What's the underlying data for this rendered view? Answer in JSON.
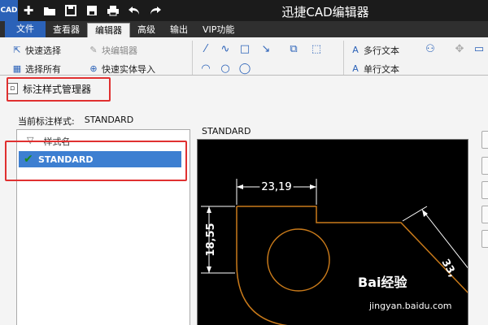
{
  "window": {
    "title": "迅捷CAD编辑器",
    "app_icon_text": "CAD"
  },
  "quick_access": [
    {
      "name": "new-icon",
      "glyph": "✚"
    },
    {
      "name": "open-folder-icon",
      "glyph": "▬"
    },
    {
      "name": "save-icon",
      "glyph": "▣"
    },
    {
      "name": "save-as-icon",
      "glyph": "▤"
    },
    {
      "name": "print-icon",
      "glyph": "⎙"
    },
    {
      "name": "undo-icon",
      "glyph": "↶"
    },
    {
      "name": "redo-icon",
      "glyph": "↷"
    }
  ],
  "tabs": [
    "文件",
    "查看器",
    "编辑器",
    "高级",
    "输出",
    "VIP功能"
  ],
  "active_tab": "编辑器",
  "ribbon": {
    "quick_select": "快速选择",
    "select_all": "选择所有",
    "block_editor": "块编辑器",
    "quick_import": "快速实体导入",
    "multiline_text": "多行文本",
    "singleline_text": "单行文本"
  },
  "dialog": {
    "title": "标注样式管理器",
    "current_style_label": "当前标注样式:",
    "current_style_value": "STANDARD",
    "list_header": "样式名",
    "styles": [
      "STANDARD"
    ],
    "preview_label": "STANDARD"
  },
  "drawing": {
    "dim_top": "23,19",
    "dim_left": "18,55",
    "dim_right": "33,"
  },
  "watermark": {
    "brand": "Bai经验",
    "sub": "jingyan.baidu.com"
  },
  "colors": {
    "accent": "#2b62b8",
    "selection": "#3d7fd1",
    "highlight": "#e03030",
    "drawing_bg": "#000000",
    "drawing_line": "#c97a1a",
    "dim_line": "#ffffff"
  }
}
